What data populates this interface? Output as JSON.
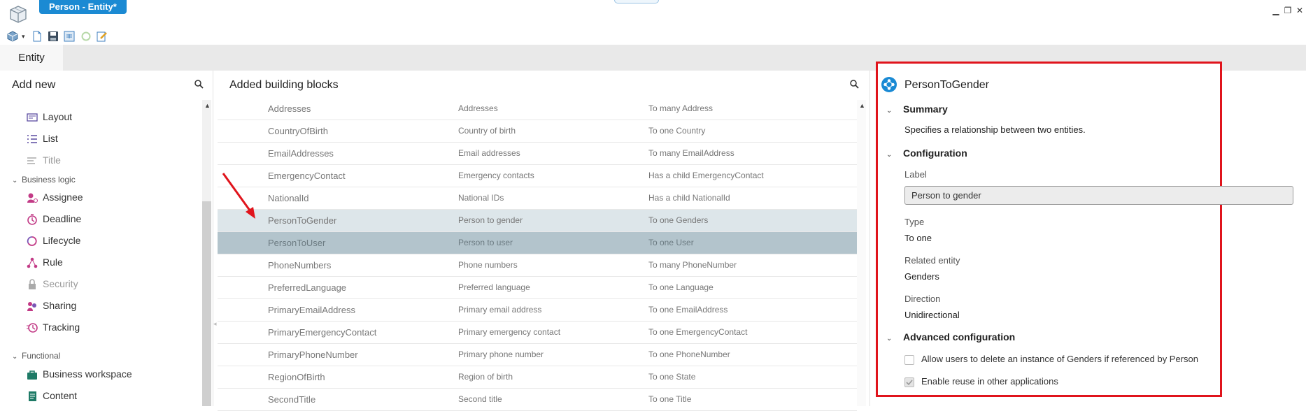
{
  "window": {
    "title": "Person - Entity*",
    "controls": [
      "minimize-icon",
      "restore-icon",
      "close-icon"
    ]
  },
  "toolbar": {
    "icons": [
      "3d-view-icon",
      "dropdown-icon",
      "new-document-icon",
      "save-icon",
      "export-icon",
      "refresh-icon",
      "edit-icon"
    ]
  },
  "tabs": [
    {
      "label": "Entity"
    }
  ],
  "left_panel": {
    "title": "Add new",
    "items_top": [
      {
        "label": "Layout",
        "icon": "layout-icon",
        "enabled": true
      },
      {
        "label": "List",
        "icon": "list-icon",
        "enabled": true
      },
      {
        "label": "Title",
        "icon": "title-icon",
        "enabled": false
      }
    ],
    "groups": [
      {
        "label": "Business logic",
        "items": [
          {
            "label": "Assignee",
            "icon": "assignee-icon",
            "enabled": true
          },
          {
            "label": "Deadline",
            "icon": "deadline-icon",
            "enabled": true
          },
          {
            "label": "Lifecycle",
            "icon": "lifecycle-icon",
            "enabled": true
          },
          {
            "label": "Rule",
            "icon": "rule-icon",
            "enabled": true
          },
          {
            "label": "Security",
            "icon": "lock-icon",
            "enabled": false
          },
          {
            "label": "Sharing",
            "icon": "sharing-icon",
            "enabled": true
          },
          {
            "label": "Tracking",
            "icon": "tracking-icon",
            "enabled": true
          }
        ]
      },
      {
        "label": "Functional",
        "items": [
          {
            "label": "Business workspace",
            "icon": "briefcase-icon",
            "enabled": true
          },
          {
            "label": "Content",
            "icon": "content-icon",
            "enabled": true
          }
        ]
      }
    ]
  },
  "middle_panel": {
    "title": "Added building blocks",
    "rows": [
      {
        "name": "Addresses",
        "label": "Addresses",
        "type": "To many Address"
      },
      {
        "name": "CountryOfBirth",
        "label": "Country of birth",
        "type": "To one Country"
      },
      {
        "name": "EmailAddresses",
        "label": "Email addresses",
        "type": "To many EmailAddress"
      },
      {
        "name": "EmergencyContact",
        "label": "Emergency contacts",
        "type": "Has a child EmergencyContact"
      },
      {
        "name": "NationalId",
        "label": "National IDs",
        "type": "Has a child NationalId"
      },
      {
        "name": "PersonToGender",
        "label": "Person to gender",
        "type": "To one Genders"
      },
      {
        "name": "PersonToUser",
        "label": "Person to user",
        "type": "To one User"
      },
      {
        "name": "PhoneNumbers",
        "label": "Phone numbers",
        "type": "To many PhoneNumber"
      },
      {
        "name": "PreferredLanguage",
        "label": "Preferred language",
        "type": "To one Language"
      },
      {
        "name": "PrimaryEmailAddress",
        "label": "Primary email address",
        "type": "To one EmailAddress"
      },
      {
        "name": "PrimaryEmergencyContact",
        "label": "Primary emergency contact",
        "type": "To one EmergencyContact"
      },
      {
        "name": "PrimaryPhoneNumber",
        "label": "Primary phone number",
        "type": "To one PhoneNumber"
      },
      {
        "name": "RegionOfBirth",
        "label": "Region of birth",
        "type": "To one State"
      },
      {
        "name": "SecondTitle",
        "label": "Second title",
        "type": "To one Title"
      }
    ]
  },
  "right_panel": {
    "title": "PersonToGender",
    "summary": {
      "heading": "Summary",
      "text": "Specifies a relationship between two entities."
    },
    "configuration": {
      "heading": "Configuration",
      "label_caption": "Label",
      "label_value": "Person to gender",
      "type_caption": "Type",
      "type_value": "To one",
      "related_caption": "Related entity",
      "related_value": "Genders",
      "direction_caption": "Direction",
      "direction_value": "Unidirectional"
    },
    "advanced": {
      "heading": "Advanced configuration",
      "options": [
        {
          "label": "Allow users to delete an instance of Genders if referenced by Person",
          "checked": false
        },
        {
          "label": "Enable reuse in other applications",
          "checked": true
        }
      ]
    }
  },
  "colors": {
    "accent": "#1b8ad3",
    "highlight_border": "#e0141c",
    "selected_row": "#b3c4cc",
    "hover_row": "#dde6ea"
  }
}
